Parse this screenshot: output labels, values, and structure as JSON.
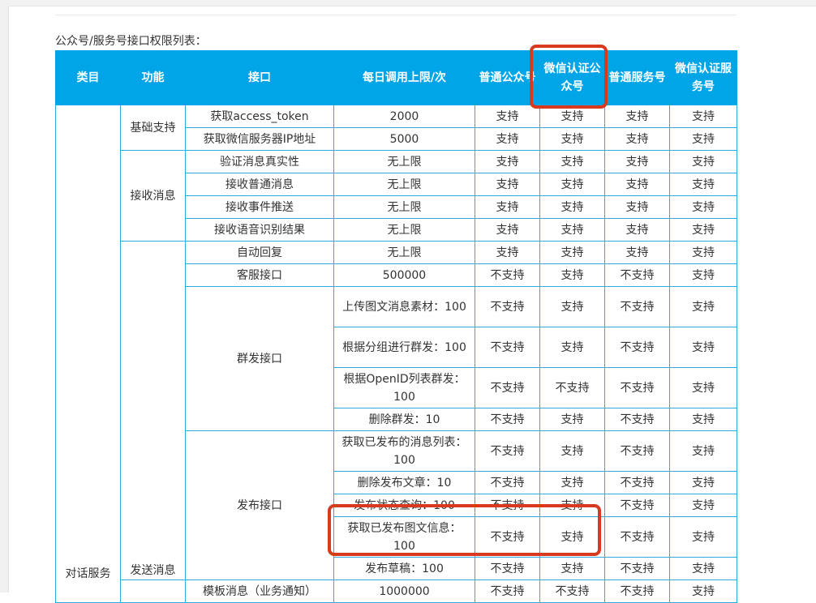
{
  "caption": "公众号/服务号接口权限列表：",
  "headers": [
    "类目",
    "功能",
    "接口",
    "每日调用上限/次",
    "普通公众号",
    "微信认证公众号",
    "普通服务号",
    "微信认证服务号"
  ],
  "category": "对话服务",
  "groups": {
    "basic": "基础支持",
    "receive": "接收消息",
    "send": "发送消息",
    "mass": "群发接口",
    "publish": "发布接口"
  },
  "rows": [
    {
      "api": "获取access_token",
      "limit": "2000",
      "c1": "支持",
      "c2": "支持",
      "c3": "支持",
      "c4": "支持"
    },
    {
      "api": "获取微信服务器IP地址",
      "limit": "5000",
      "c1": "支持",
      "c2": "支持",
      "c3": "支持",
      "c4": "支持"
    },
    {
      "api": "验证消息真实性",
      "limit": "无上限",
      "c1": "支持",
      "c2": "支持",
      "c3": "支持",
      "c4": "支持"
    },
    {
      "api": "接收普通消息",
      "limit": "无上限",
      "c1": "支持",
      "c2": "支持",
      "c3": "支持",
      "c4": "支持"
    },
    {
      "api": "接收事件推送",
      "limit": "无上限",
      "c1": "支持",
      "c2": "支持",
      "c3": "支持",
      "c4": "支持"
    },
    {
      "api": "接收语音识别结果",
      "limit": "无上限",
      "c1": "支持",
      "c2": "支持",
      "c3": "支持",
      "c4": "支持"
    },
    {
      "api": "自动回复",
      "limit": "无上限",
      "c1": "支持",
      "c2": "支持",
      "c3": "支持",
      "c4": "支持"
    },
    {
      "api": "客服接口",
      "limit": "500000",
      "c1": "不支持",
      "c2": "支持",
      "c3": "不支持",
      "c4": "支持"
    },
    {
      "limit": "上传图文消息素材：100",
      "c1": "不支持",
      "c2": "支持",
      "c3": "不支持",
      "c4": "支持"
    },
    {
      "limit": "根据分组进行群发：100",
      "c1": "不支持",
      "c2": "支持",
      "c3": "不支持",
      "c4": "支持"
    },
    {
      "limit": "根据OpenID列表群发：100",
      "c1": "不支持",
      "c2": "不支持",
      "c3": "不支持",
      "c4": "支持"
    },
    {
      "limit": "删除群发：10",
      "c1": "不支持",
      "c2": "支持",
      "c3": "不支持",
      "c4": "支持"
    },
    {
      "limit": "获取已发布的消息列表：100",
      "c1": "不支持",
      "c2": "支持",
      "c3": "不支持",
      "c4": "支持"
    },
    {
      "limit": "删除发布文章：10",
      "c1": "不支持",
      "c2": "支持",
      "c3": "不支持",
      "c4": "支持"
    },
    {
      "limit": "发布状态查询：100",
      "c1": "不支持",
      "c2": "支持",
      "c3": "不支持",
      "c4": "支持"
    },
    {
      "limit": "获取已发布图文信息：100",
      "c1": "不支持",
      "c2": "支持",
      "c3": "不支持",
      "c4": "支持"
    },
    {
      "limit": "发布草稿：100",
      "c1": "不支持",
      "c2": "支持",
      "c3": "不支持",
      "c4": "支持"
    },
    {
      "api": "模板消息（业务通知）",
      "limit": "1000000",
      "c1": "不支持",
      "c2": "不支持",
      "c3": "不支持",
      "c4": "支持"
    }
  ],
  "colors": {
    "header_bg": "#00a5e8",
    "border": "#2ba9e0",
    "highlight": "#d83a1f"
  }
}
